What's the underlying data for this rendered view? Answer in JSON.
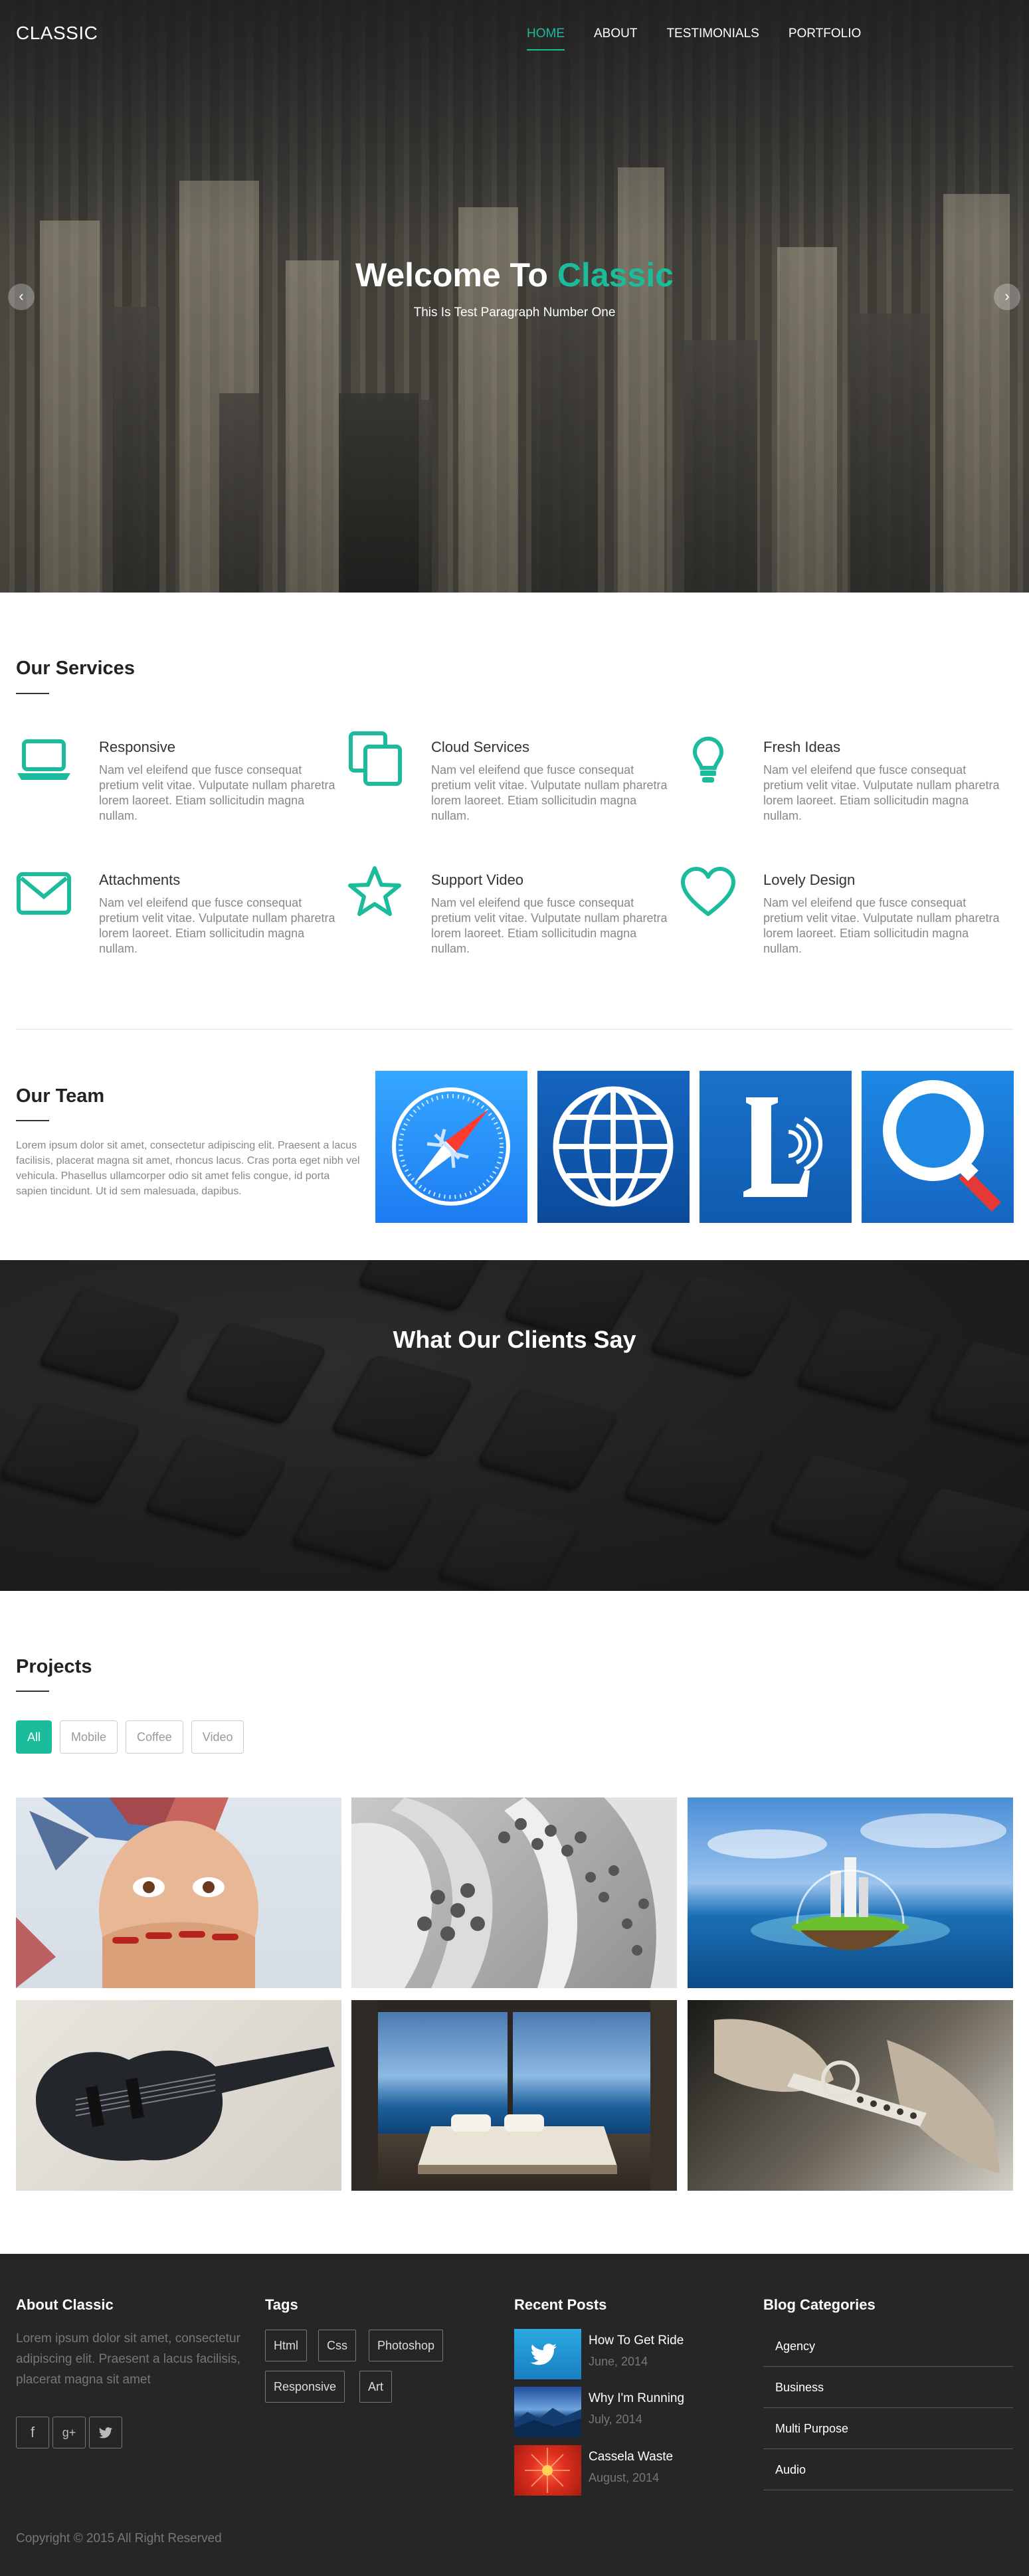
{
  "header": {
    "brand": "CLASSIC",
    "nav": [
      {
        "label": "HOME",
        "active": true
      },
      {
        "label": "ABOUT",
        "active": false
      },
      {
        "label": "TESTIMONIALS",
        "active": false
      },
      {
        "label": "PORTFOLIO",
        "active": false
      }
    ]
  },
  "hero": {
    "title_prefix": "Welcome To ",
    "title_accent": "Classic",
    "subtitle": "This Is Test Paragraph Number One",
    "prev_icon": "chevron-left-icon",
    "next_icon": "chevron-right-icon"
  },
  "services": {
    "heading": "Our Services",
    "items": [
      {
        "icon": "laptop-icon",
        "title": "Responsive",
        "text": "Nam vel eleifend que fusce consequat pretium velit vitae. Vulputate nullam pharetra lorem laoreet. Etiam sollicitudin magna nullam."
      },
      {
        "icon": "copy-icon",
        "title": "Cloud Services",
        "text": "Nam vel eleifend que fusce consequat pretium velit vitae. Vulputate nullam pharetra lorem laoreet. Etiam sollicitudin magna nullam."
      },
      {
        "icon": "lightbulb-icon",
        "title": "Fresh Ideas",
        "text": "Nam vel eleifend que fusce consequat pretium velit vitae. Vulputate nullam pharetra lorem laoreet. Etiam sollicitudin magna nullam."
      },
      {
        "icon": "envelope-icon",
        "title": "Attachments",
        "text": "Nam vel eleifend que fusce consequat pretium velit vitae. Vulputate nullam pharetra lorem laoreet. Etiam sollicitudin magna nullam."
      },
      {
        "icon": "star-icon",
        "title": "Support Video",
        "text": "Nam vel eleifend que fusce consequat pretium velit vitae. Vulputate nullam pharetra lorem laoreet. Etiam sollicitudin magna nullam."
      },
      {
        "icon": "heart-icon",
        "title": "Lovely Design",
        "text": "Nam vel eleifend que fusce consequat pretium velit vitae. Vulputate nullam pharetra lorem laoreet. Etiam sollicitudin magna nullam."
      }
    ]
  },
  "team": {
    "heading": "Our Team",
    "text": "Lorem ipsum dolor sit amet, consectetur adipiscing elit. Praesent a lacus facilisis, placerat magna sit amet, rhoncus lacus. Cras porta eget nibh vel vehicula. Phasellus ullamcorper odio sit amet felis congue, id porta sapien tincidunt. Ut id sem malesuada, dapibus.",
    "tiles": [
      "safari-compass-icon",
      "globe-icon",
      "lingvo-l-icon",
      "magnifier-icon"
    ]
  },
  "clients": {
    "heading": "What Our Clients Say"
  },
  "projects": {
    "heading": "Projects",
    "filters": [
      {
        "label": "All",
        "active": true
      },
      {
        "label": "Mobile",
        "active": false
      },
      {
        "label": "Coffee",
        "active": false
      },
      {
        "label": "Video",
        "active": false
      }
    ],
    "items": [
      "painted-face-image",
      "white-tubes-image",
      "island-globe-image",
      "bass-guitar-image",
      "bedroom-sea-view-image",
      "hands-tool-image"
    ]
  },
  "footer": {
    "about": {
      "title": "About Classic",
      "text": "Lorem ipsum dolor sit amet, consectetur adipiscing elit. Praesent a lacus facilisis, placerat magna sit amet",
      "social": [
        {
          "icon": "facebook-icon",
          "glyph": "f"
        },
        {
          "icon": "google-plus-icon",
          "glyph": "g+"
        },
        {
          "icon": "twitter-icon",
          "glyph": "t"
        }
      ]
    },
    "tags": {
      "title": "Tags",
      "items": [
        "Html",
        "Css",
        "Photoshop",
        "Responsive",
        "Art"
      ]
    },
    "recent_posts": {
      "title": "Recent Posts",
      "items": [
        {
          "title": "How To Get Ride",
          "date": "June, 2014",
          "thumb": "twitter-bird-thumb"
        },
        {
          "title": "Why I'm Running",
          "date": "July, 2014",
          "thumb": "blue-mountains-thumb"
        },
        {
          "title": "Cassela Waste",
          "date": "August, 2014",
          "thumb": "red-flower-thumb"
        }
      ]
    },
    "categories": {
      "title": "Blog Categories",
      "items": [
        "Agency",
        "Business",
        "Multi Purpose",
        "Audio"
      ]
    },
    "copyright": "Copyright © 2015 All Right Reserved"
  },
  "colors": {
    "accent": "#1abc9c",
    "footer_bg": "#262626",
    "text_muted": "#888888"
  }
}
